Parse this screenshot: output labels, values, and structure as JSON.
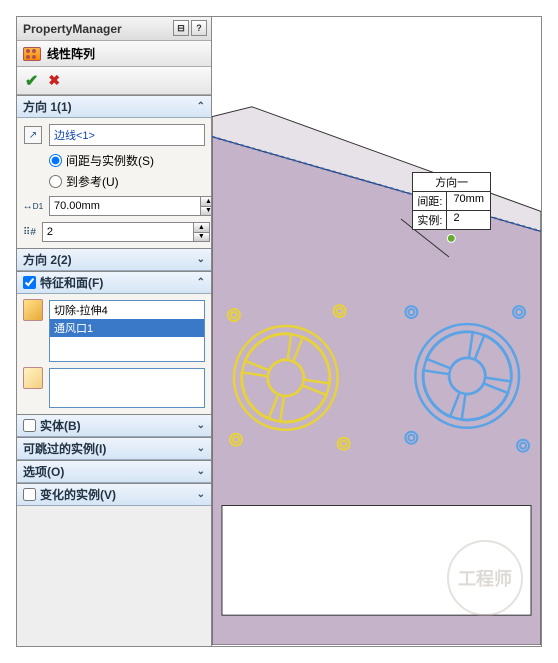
{
  "header": {
    "title": "PropertyManager"
  },
  "feature": {
    "title": "线性阵列"
  },
  "direction1": {
    "title": "方向 1(1)",
    "edge": "边线<1>",
    "radio_spacing": "间距与实例数(S)",
    "radio_ref": "到参考(U)",
    "spacing": "70.00mm",
    "count": "2"
  },
  "direction2": {
    "title": "方向 2(2)"
  },
  "features": {
    "title": "特征和面(F)",
    "items": [
      "切除-拉伸4",
      "通风口1"
    ]
  },
  "solids": {
    "title": "实体(B)"
  },
  "skip": {
    "title": "可跳过的实例(I)"
  },
  "options": {
    "title": "选项(O)"
  },
  "vary": {
    "title": "变化的实例(V)"
  },
  "callout": {
    "title": "方向一",
    "spacing_label": "间距:",
    "spacing_value": "70mm",
    "count_label": "实例:",
    "count_value": "2"
  },
  "watermark": "工程师"
}
